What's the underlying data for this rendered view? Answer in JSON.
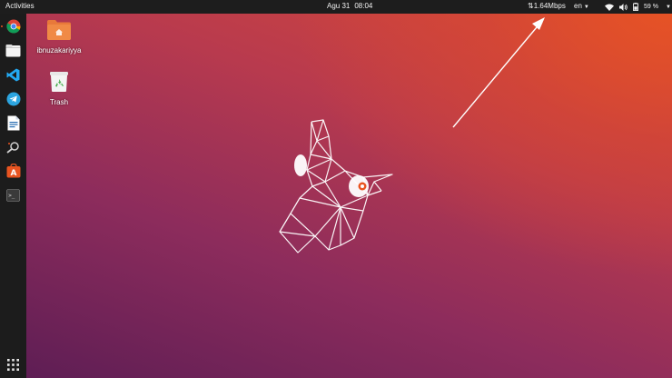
{
  "topbar": {
    "activities_label": "Activities",
    "clock_date": "Agu 31",
    "clock_time": "08:04",
    "net_speed": "⇅1.64Mbps",
    "language": "en",
    "battery_percent": "59 %"
  },
  "dock": {
    "items": [
      {
        "icon": "chrome-icon"
      },
      {
        "icon": "files-icon"
      },
      {
        "icon": "vscode-icon"
      },
      {
        "icon": "telegram-icon"
      },
      {
        "icon": "writer-icon"
      },
      {
        "icon": "screenshot-icon"
      },
      {
        "icon": "software-center-icon"
      },
      {
        "icon": "terminal-icon"
      }
    ],
    "show_apps_icon": "grid-icon"
  },
  "desktop": {
    "icons": [
      {
        "label": "ibnuzakariyya",
        "icon": "home-folder-icon"
      },
      {
        "label": "Trash",
        "icon": "trash-icon"
      }
    ]
  },
  "colors": {
    "accent": "#e95420",
    "topbar": "#1d1d1d",
    "dock": "#1c1c1c"
  }
}
